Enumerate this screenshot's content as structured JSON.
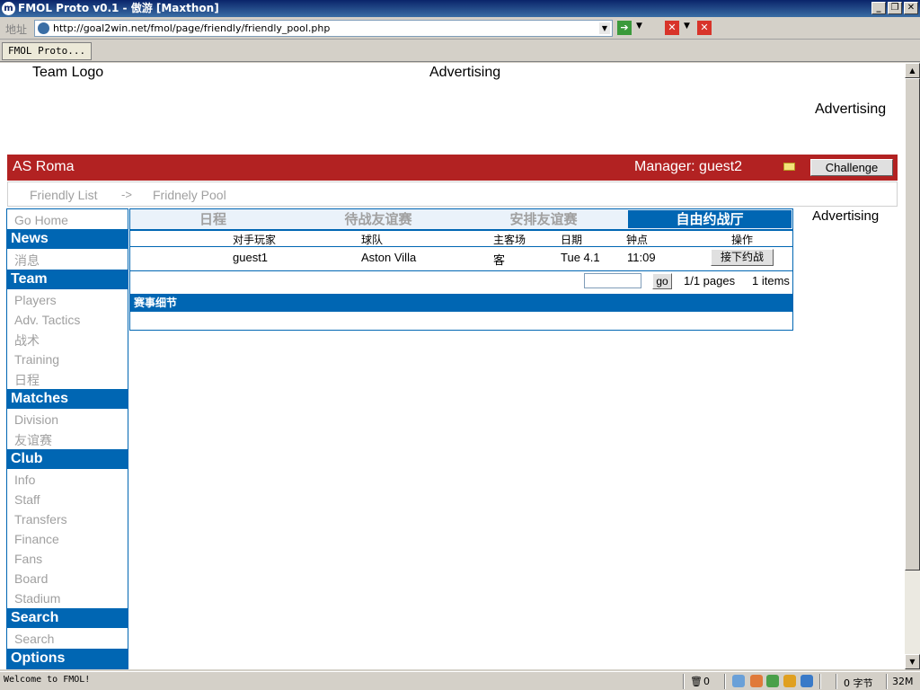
{
  "window": {
    "title": "FMOL Proto v0.1 - 傲游 [Maxthon]",
    "icon": "maxthon-icon"
  },
  "address_bar": {
    "label": "地址",
    "url": "http://goal2win.net/fmol/page/friendly/friendly_pool.php"
  },
  "browser_tabs": [
    {
      "label": "FMOL Proto..."
    }
  ],
  "status_bar": {
    "message": "Welcome to FMOL!",
    "trash_count": "0",
    "bytes": "0 字节",
    "memory": "32M"
  },
  "page": {
    "team_logo": "Team Logo",
    "advertising_top": "Advertising",
    "advertising_right": "Advertising",
    "advertising_side": "Advertising",
    "header": {
      "team": "AS Roma",
      "manager": "Manager: guest2",
      "challenge_label": "Challenge",
      "mail_icon": "envelope-icon"
    },
    "breadcrumb": {
      "parent": "Friendly List",
      "separator": "->",
      "current": "Fridnely Pool"
    },
    "sidebar": {
      "go_home": "Go Home",
      "news": {
        "title": "News",
        "items": [
          "消息"
        ]
      },
      "team": {
        "title": "Team",
        "items": [
          "Players",
          "Adv. Tactics",
          "战术",
          "Training",
          "日程"
        ]
      },
      "matches": {
        "title": "Matches",
        "items": [
          "Division",
          "友谊赛"
        ]
      },
      "club": {
        "title": "Club",
        "items": [
          "Info",
          "Staff",
          "Transfers",
          "Finance",
          "Fans",
          "Board",
          "Stadium"
        ]
      },
      "search": {
        "title": "Search",
        "items": [
          "Search"
        ]
      },
      "options": {
        "title": "Options"
      }
    },
    "tabs": [
      "日程",
      "待战友谊赛",
      "安排友谊赛",
      "自由约战厅"
    ],
    "active_tab": 3,
    "table": {
      "headers": [
        "对手玩家",
        "球队",
        "主客场",
        "日期",
        "钟点",
        "操作"
      ],
      "rows": [
        {
          "opponent": "guest1",
          "team": "Aston Villa",
          "venue": "客",
          "date": "Tue 4.1",
          "time": "11:09",
          "action": "接下约战"
        }
      ]
    },
    "pagination": {
      "go_label": "go",
      "pages": "1/1 pages",
      "items": "1 items"
    },
    "details_title": "赛事细节"
  }
}
